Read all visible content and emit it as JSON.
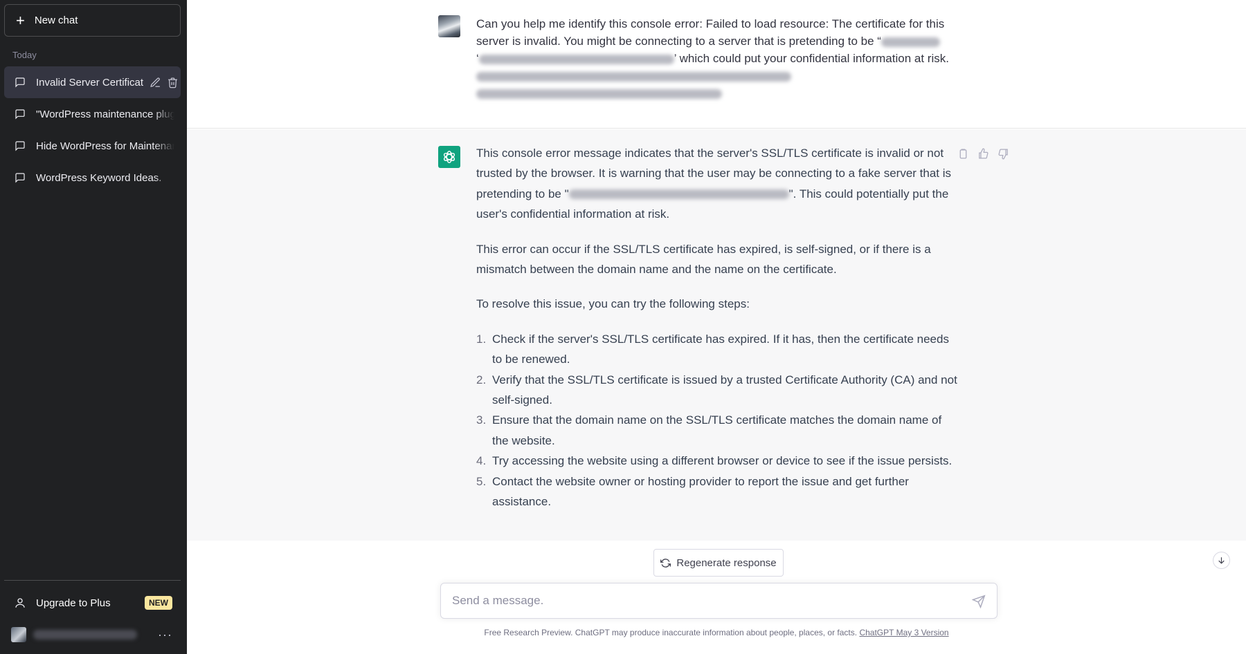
{
  "sidebar": {
    "new_chat_label": "New chat",
    "section_label": "Today",
    "conversations": [
      {
        "label": "Invalid Server Certificat"
      },
      {
        "label": "\"WordPress maintenance plugin"
      },
      {
        "label": "Hide WordPress for Maintenance"
      },
      {
        "label": "WordPress Keyword Ideas."
      }
    ],
    "upgrade_label": "Upgrade to Plus",
    "upgrade_badge": "NEW",
    "account_more": "···"
  },
  "chat": {
    "user_message": {
      "part1": "Can you help me identify this console error: Failed to load resource: The certificate for this server is invalid. You might be connecting to a server that is pretending to be “",
      "part2": "’ which could put your confidential information at risk."
    },
    "assistant_message": {
      "p1_start": "This console error message indicates that the server's SSL/TLS certificate is invalid or not trusted by the browser. It is warning that the user may be connecting to a fake server that is pretending to be \"",
      "p1_end": "\". This could potentially put the user's confidential information at risk.",
      "p2": "This error can occur if the SSL/TLS certificate has expired, is self-signed, or if there is a mismatch between the domain name and the name on the certificate.",
      "p3": "To resolve this issue, you can try the following steps:",
      "steps": [
        {
          "num": "1.",
          "text": "Check if the server's SSL/TLS certificate has expired. If it has, then the certificate needs to be renewed."
        },
        {
          "num": "2.",
          "text": "Verify that the SSL/TLS certificate is issued by a trusted Certificate Authority (CA) and not self-signed."
        },
        {
          "num": "3.",
          "text": "Ensure that the domain name on the SSL/TLS certificate matches the domain name of the website."
        },
        {
          "num": "4.",
          "text": "Try accessing the website using a different browser or device to see if the issue persists."
        },
        {
          "num": "5.",
          "text": "Contact the website owner or hosting provider to report the issue and get further assistance."
        }
      ]
    }
  },
  "composer": {
    "regenerate_label": "Regenerate response",
    "placeholder": "Send a message.",
    "footer_text": "Free Research Preview. ChatGPT may produce inaccurate information about people, places, or facts. ",
    "footer_link": "ChatGPT May 3 Version"
  },
  "icons": {
    "new_chat": "plus-icon",
    "conversation": "chat-bubble-icon",
    "edit": "pencil-icon",
    "delete": "trash-icon",
    "upgrade": "user-icon",
    "copy": "clipboard-icon",
    "like": "thumbs-up-icon",
    "dislike": "thumbs-down-icon",
    "regenerate": "refresh-icon",
    "send": "paper-plane-icon",
    "scroll": "arrow-down-icon",
    "assistant": "openai-logo-icon"
  },
  "colors": {
    "sidebar_bg": "#202123",
    "active_item_bg": "#343541",
    "assistant_row_bg": "#f7f7f8",
    "brand_green": "#10a37f",
    "badge_bg": "#fae69e"
  }
}
